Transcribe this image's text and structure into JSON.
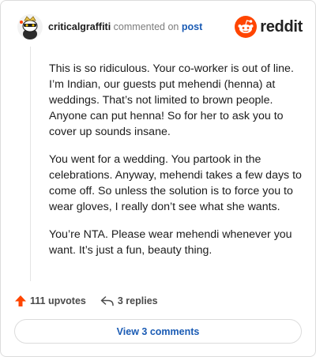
{
  "header": {
    "username": "criticalgraffiti",
    "action_text": "commented on",
    "post_link": "post",
    "brand_name": "reddit",
    "brand_color": "#ff4500",
    "avatar_icon": "snoo-avatar-icon"
  },
  "comment": {
    "paragraphs": [
      "This is so ridiculous. Your co-worker is out of line. I’m Indian, our guests put mehendi (henna) at weddings. That’s not limited to brown people. Anyone can put henna! So for her to ask you to cover up sounds insane.",
      "You went for a wedding. You partook in the celebrations. Anyway, mehendi takes a few days to come off. So unless the solution is to force you to wear gloves, I really don’t see what she wants.",
      "You’re NTA. Please wear mehendi whenever you want. It’s just a fun, beauty thing."
    ]
  },
  "actions": {
    "upvotes_label": "111 upvotes",
    "replies_label": "3 replies",
    "upvote_color": "#ff4500"
  },
  "view_comments_label": "View 3 comments",
  "link_color": "#1a5bb4"
}
